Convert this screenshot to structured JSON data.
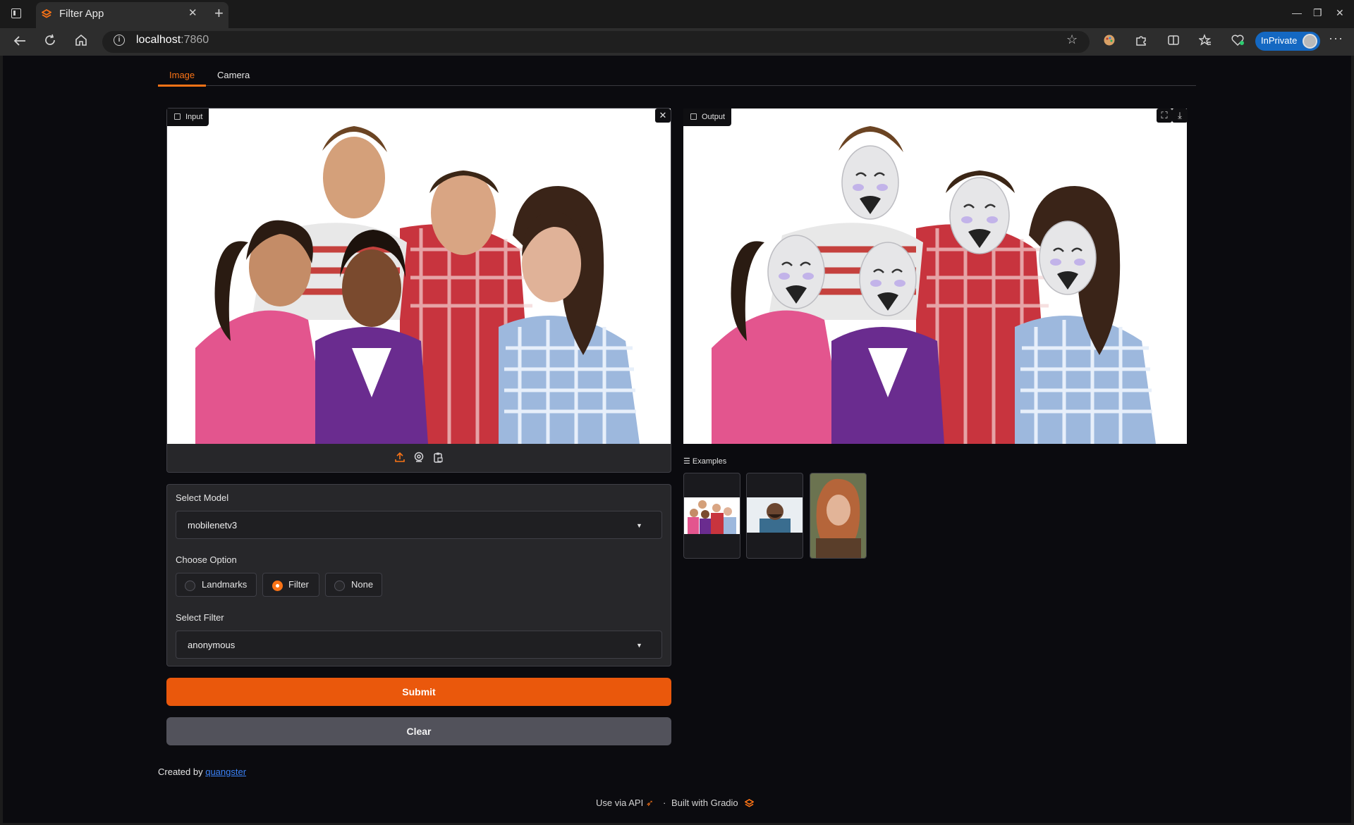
{
  "browser": {
    "tab_title": "Filter App",
    "tab_close": "✕",
    "new_tab": "+",
    "address_host": "localhost",
    "address_port": ":7860",
    "inprivate_label": "InPrivate",
    "window_min": "—",
    "window_restore": "❐",
    "window_close": "✕"
  },
  "tabs": {
    "image": "Image",
    "camera": "Camera"
  },
  "input": {
    "label": "Input"
  },
  "output": {
    "label": "Output"
  },
  "form": {
    "model_label": "Select Model",
    "model_value": "mobilenetv3",
    "option_label": "Choose Option",
    "options": [
      "Landmarks",
      "Filter",
      "None"
    ],
    "selected_option": "Filter",
    "filter_label": "Select Filter",
    "filter_value": "anonymous"
  },
  "buttons": {
    "submit": "Submit",
    "clear": "Clear"
  },
  "credit": {
    "prefix": "Created by",
    "author": "quangster"
  },
  "examples": {
    "label": "Examples"
  },
  "footer": {
    "api": "Use via API",
    "separator": "·",
    "built": "Built with Gradio"
  },
  "colors": {
    "accent": "#f97316",
    "submit_bg": "#ea580c",
    "clear_bg": "#52525b",
    "link": "#3b82f6",
    "inprivate_bg": "#1468c2"
  },
  "icons": {
    "back": "arrow-left-icon",
    "refresh": "refresh-icon",
    "home": "home-icon",
    "upload": "upload-icon",
    "webcam": "webcam-icon",
    "clipboard": "clipboard-icon",
    "fullscreen": "fullscreen-icon",
    "download": "download-icon",
    "close": "close-icon"
  }
}
